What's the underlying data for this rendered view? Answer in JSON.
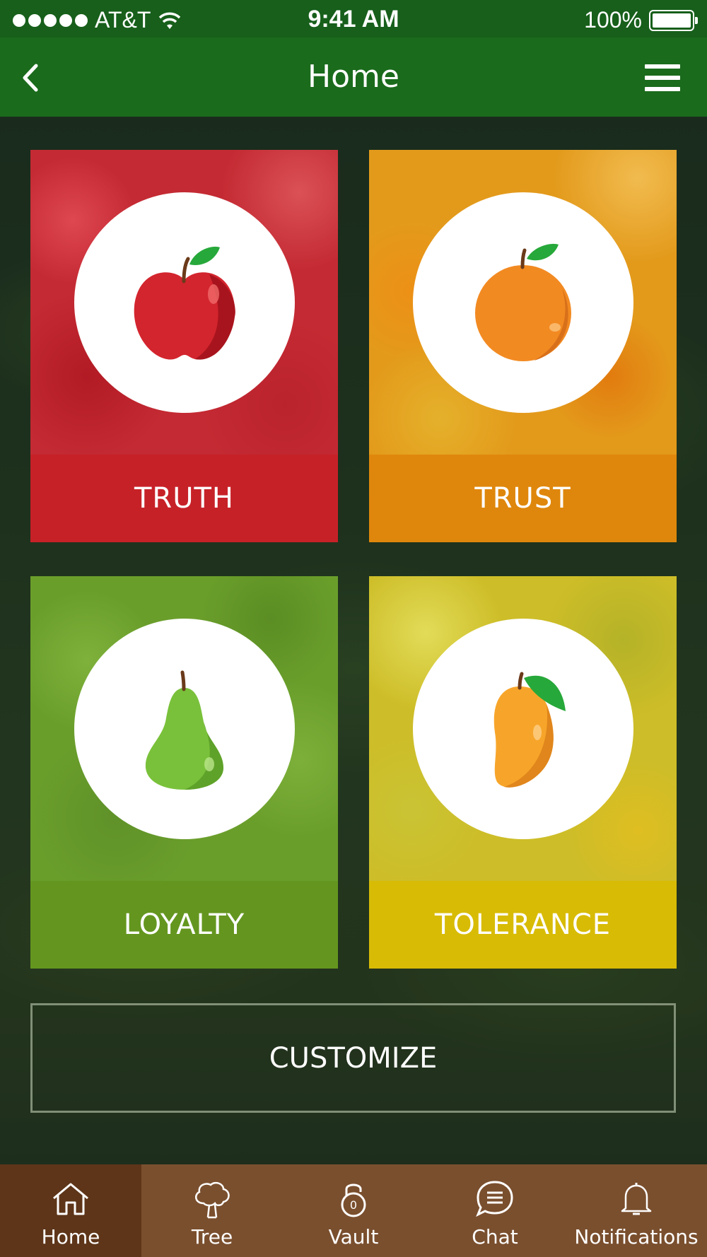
{
  "status_bar": {
    "carrier": "AT&T",
    "time": "9:41 AM",
    "battery": "100%"
  },
  "nav": {
    "title": "Home"
  },
  "tiles": [
    {
      "label": "TRUTH",
      "icon": "apple-icon",
      "color": "#c72128"
    },
    {
      "label": "TRUST",
      "icon": "orange-icon",
      "color": "#df870c"
    },
    {
      "label": "LOYALTY",
      "icon": "pear-icon",
      "color": "#64961f"
    },
    {
      "label": "TOLERANCE",
      "icon": "mango-icon",
      "color": "#d8bb05"
    }
  ],
  "customize": {
    "label": "CUSTOMIZE"
  },
  "tab_bar": {
    "items": [
      {
        "label": "Home",
        "icon": "house-icon",
        "active": true
      },
      {
        "label": "Tree",
        "icon": "tree-icon",
        "active": false
      },
      {
        "label": "Vault",
        "icon": "lock-icon",
        "active": false,
        "badge": "0"
      },
      {
        "label": "Chat",
        "icon": "chat-bubble-icon",
        "active": false
      },
      {
        "label": "Notifications",
        "icon": "bell-icon",
        "active": false
      }
    ]
  },
  "colors": {
    "status_bar": "#175f1b",
    "nav_bar": "#1a6b1c",
    "tab_bar": "#7a4f2e",
    "tab_active": "#5e3519"
  }
}
